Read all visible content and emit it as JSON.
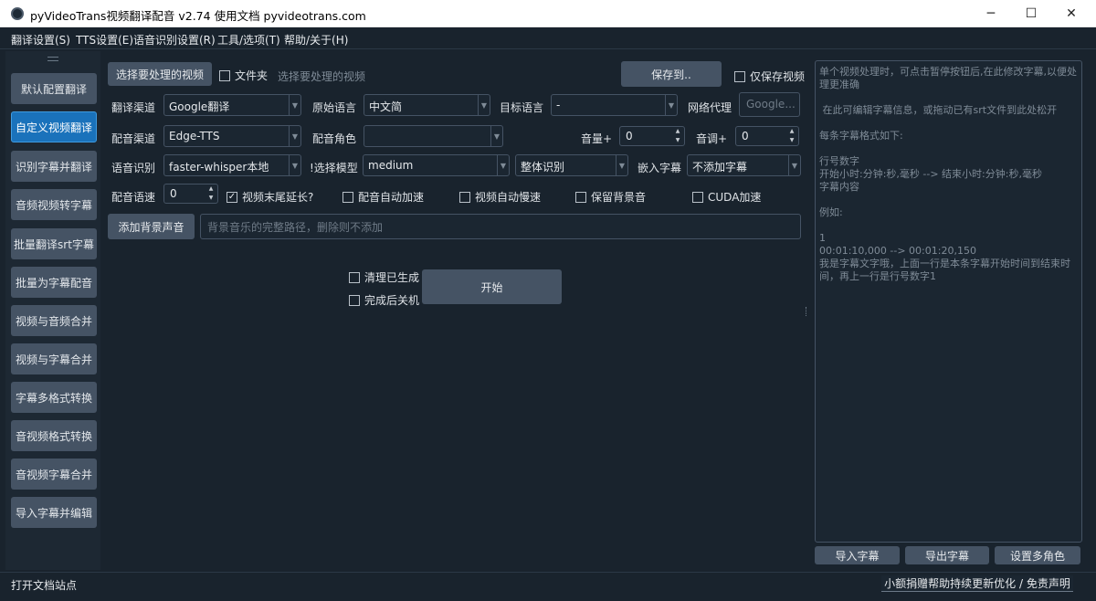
{
  "window": {
    "title": "pyVideoTrans视频翻译配音 v2.74  使用文档  pyvideotrans.com",
    "min_glyph": "─",
    "max_glyph": "☐",
    "close_glyph": "✕"
  },
  "menu": [
    "翻译设置(S)",
    "TTS设置(E)",
    "语音识别设置(R)",
    "工具/选项(T)",
    "帮助/关于(H)"
  ],
  "sidebar": {
    "items": [
      "默认配置翻译",
      "自定义视频翻译",
      "识别字幕并翻译",
      "音频视频转字幕",
      "批量翻译srt字幕",
      "批量为字幕配音",
      "视频与音频合并",
      "视频与字幕合并",
      "字幕多格式转换",
      "音视频格式转换",
      "音视频字幕合并",
      "导入字幕并编辑"
    ],
    "active_index": 1
  },
  "main": {
    "select_video_button": "选择要处理的视频",
    "folder_checkbox": "文件夹",
    "folder_checked": false,
    "video_path_placeholder": "选择要处理的视频",
    "save_to_button": "保存到..",
    "only_save_video": "仅保存视频",
    "only_save_video_checked": false,
    "translate_channel_label": "翻译渠道",
    "translate_channel_value": "Google翻译",
    "source_language_label": "原始语言",
    "source_language_value": "中文简",
    "target_language_label": "目标语言",
    "target_language_value": "-",
    "proxy_label": "网络代理",
    "proxy_placeholder": "Google...",
    "dubbing_channel_label": "配音渠道",
    "dubbing_channel_value": "Edge-TTS",
    "voice_role_label": "配音角色",
    "voice_role_value": "",
    "volume_label": "音量+",
    "volume_value": "0",
    "pitch_label": "音调+",
    "pitch_value": "0",
    "speech_recognition_label": "语音识别",
    "speech_recognition_value": "faster-whisper本地",
    "model_label": "!选择模型",
    "model_value": "medium",
    "recognition_mode_value": "整体识别",
    "embed_subtitle_label": "嵌入字幕",
    "embed_subtitle_value": "不添加字幕",
    "dubbing_speed_label": "配音语速",
    "dubbing_speed_value": "0",
    "video_extend_label": "视频末尾延长?",
    "video_extend_checked": true,
    "dub_auto_speedup_label": "配音自动加速",
    "dub_auto_speedup_checked": false,
    "video_auto_slow_label": "视频自动慢速",
    "video_auto_slow_checked": false,
    "keep_background_label": "保留背景音",
    "keep_background_checked": false,
    "cuda_label": "CUDA加速",
    "cuda_checked": false,
    "add_background_button": "添加背景声音",
    "background_path_placeholder": "背景音乐的完整路径，删除则不添加",
    "clean_generated_label": "清理已生成",
    "clean_generated_checked": false,
    "shutdown_label": "完成后关机",
    "shutdown_checked": false,
    "start_button": "开始"
  },
  "right_panel": {
    "subtitle_text": "单个视频处理时，可点击暂停按钮后,在此修改字幕,以便处理更准确\n\n 在此可编辑字幕信息，或拖动已有srt文件到此处松开\n\n每条字幕格式如下:\n\n行号数字\n开始小时:分钟:秒,毫秒 --> 结束小时:分钟:秒,毫秒\n字幕内容\n\n例如:\n\n1\n00:01:10,000 --> 00:01:20,150\n我是字幕文字哦，上面一行是本条字幕开始时间到结束时间，再上一行是行号数字1",
    "import_button": "导入字幕",
    "export_button": "导出字幕",
    "multi_role_button": "设置多角色"
  },
  "status": {
    "left": "打开文档站点",
    "right": "小额捐赠帮助持续更新优化 / 免责声明"
  },
  "colors": {
    "background": "#19232d",
    "button": "#455364",
    "accent": "#1a72bb"
  }
}
